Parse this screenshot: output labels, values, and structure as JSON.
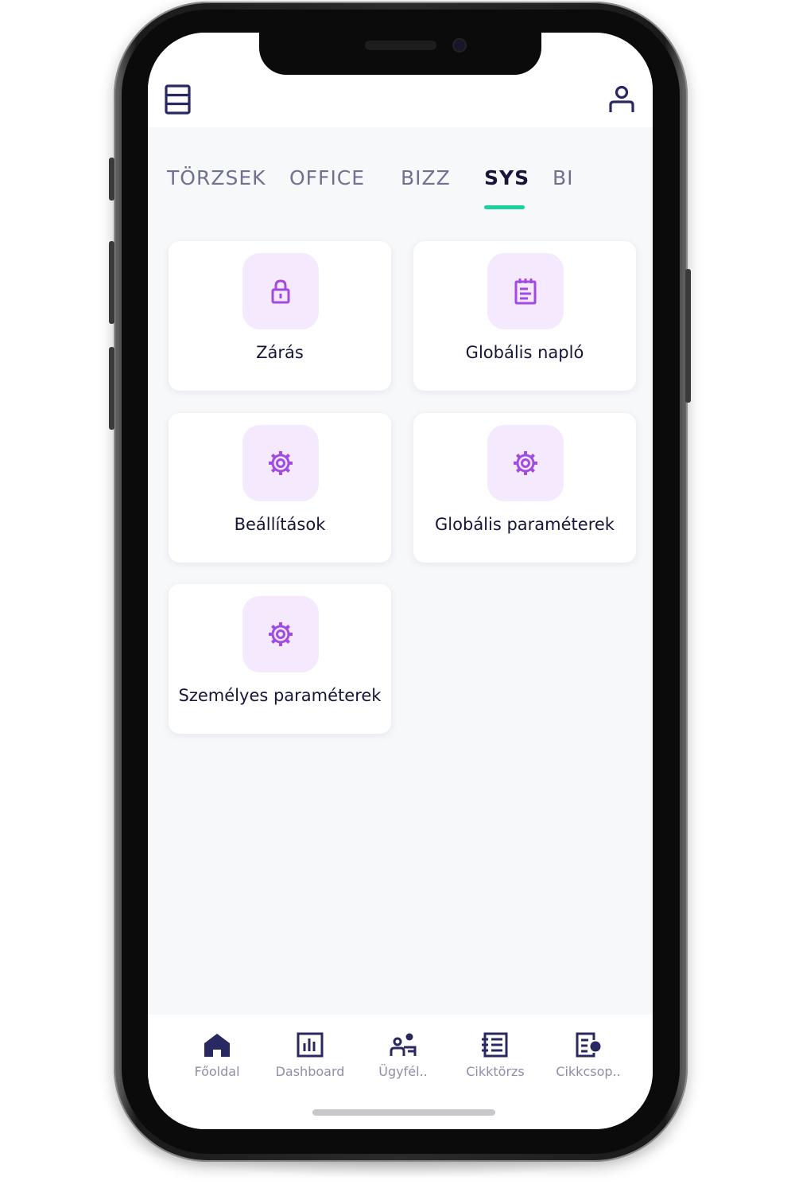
{
  "theme": {
    "accent": "#1ecfa0",
    "icon_purple": "#a24be0",
    "tile_background": "#f5e9fd",
    "text_dark": "#17163a",
    "text_muted": "#6e7191"
  },
  "header": {
    "menu_icon": "menu-icon",
    "user_icon": "user-icon"
  },
  "tabs": [
    {
      "label": "TÖRZSEK",
      "active": false
    },
    {
      "label": "OFFICE",
      "active": false
    },
    {
      "label": "BIZZ",
      "active": false
    },
    {
      "label": "SYS",
      "active": true
    },
    {
      "label": "BI",
      "active": false
    }
  ],
  "cards": [
    {
      "label": "Zárás",
      "icon": "lock-icon"
    },
    {
      "label": "Globális napló",
      "icon": "notepad-icon"
    },
    {
      "label": "Beállítások",
      "icon": "gear-icon"
    },
    {
      "label": "Globális paraméterek",
      "icon": "gear-icon"
    },
    {
      "label": "Személyes paraméterek",
      "icon": "gear-icon"
    }
  ],
  "bottom_nav": [
    {
      "label": "Főoldal",
      "icon": "home-icon"
    },
    {
      "label": "Dashboard",
      "icon": "bar-chart-icon"
    },
    {
      "label": "Ügyfél..",
      "icon": "customers-icon"
    },
    {
      "label": "Cikktörzs",
      "icon": "list-icon"
    },
    {
      "label": "Cikkcsop..",
      "icon": "category-list-icon"
    }
  ]
}
